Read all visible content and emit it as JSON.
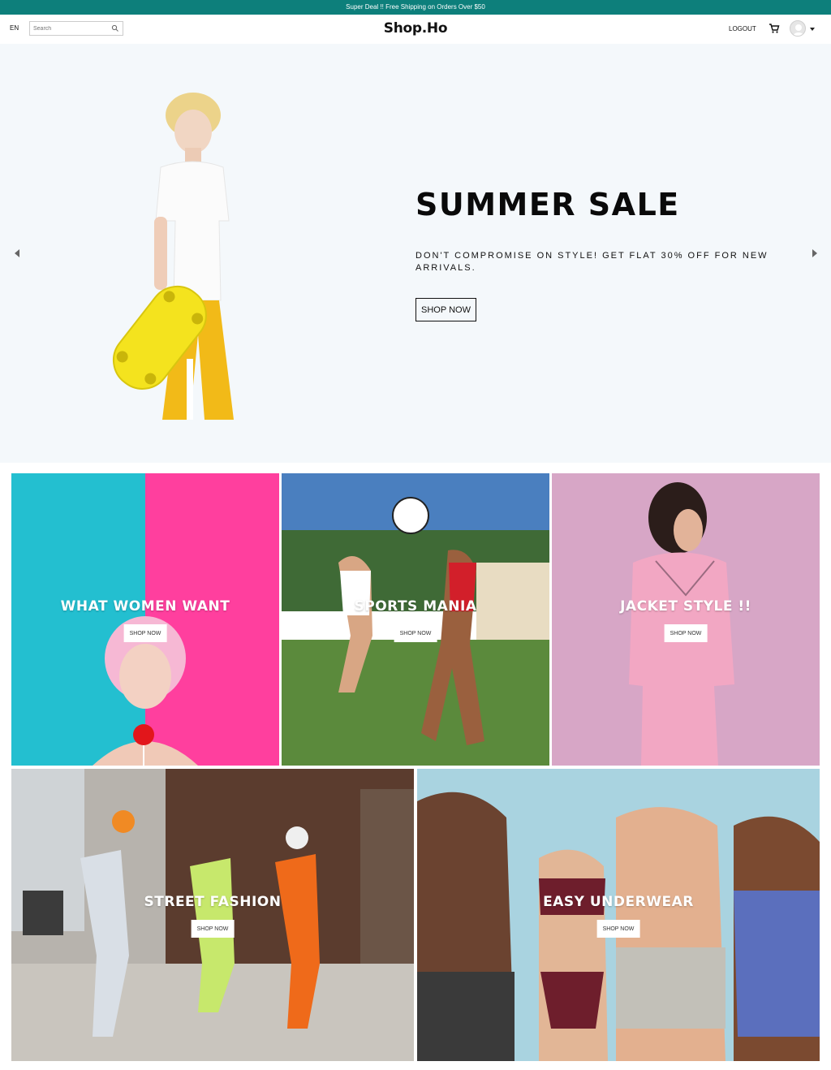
{
  "announcement": "Super Deal !! Free Shipping on Orders Over $50",
  "nav": {
    "lang": "EN",
    "search_placeholder": "Search",
    "logo": "Shop.Ho",
    "logout": "LOGOUT"
  },
  "hero": {
    "title": "SUMMER SALE",
    "description": "DON'T COMPROMISE ON STYLE! GET FLAT 30% OFF FOR NEW ARRIVALS.",
    "button": "SHOP NOW"
  },
  "categories": [
    {
      "title": "WHAT WOMEN WANT",
      "button": "SHOP NOW"
    },
    {
      "title": "SPORTS MANIA",
      "button": "SHOP NOW"
    },
    {
      "title": "JACKET STYLE !!",
      "button": "SHOP NOW"
    },
    {
      "title": "STREET FASHION",
      "button": "SHOP NOW"
    },
    {
      "title": "EASY UNDERWEAR",
      "button": "SHOP NOW"
    }
  ],
  "colors": {
    "announcement_bg": "#0d7f7b",
    "hero_bg": "#f4f8fb"
  },
  "icons": [
    "search-icon",
    "cart-icon",
    "user-avatar-icon",
    "chevron-down-icon",
    "arrow-left-icon",
    "arrow-right-icon"
  ]
}
